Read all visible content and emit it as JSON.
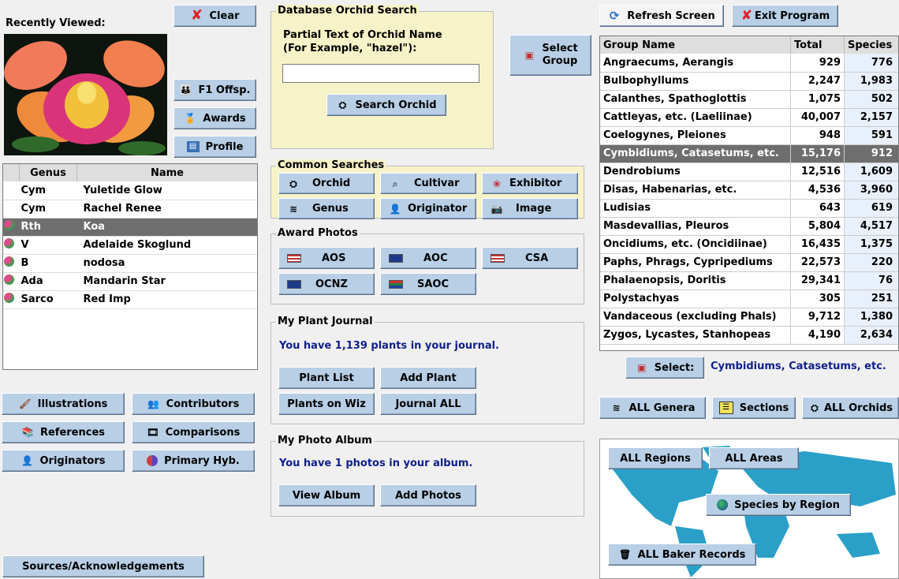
{
  "recent": {
    "title": "Recently Viewed:",
    "clear": "Clear",
    "f1": "F1 Offsp.",
    "awards": "Awards",
    "profile": "Profile",
    "headers": [
      "Genus",
      "Name"
    ],
    "rows": [
      {
        "genus": "Cym",
        "name": "Yuletide Glow",
        "icon": false
      },
      {
        "genus": "Cym",
        "name": "Rachel Renee",
        "icon": false
      },
      {
        "genus": "Rth",
        "name": "Koa",
        "icon": true
      },
      {
        "genus": "V",
        "name": "Adelaide Skoglund",
        "icon": true
      },
      {
        "genus": "B",
        "name": "nodosa",
        "icon": true
      },
      {
        "genus": "Ada",
        "name": "Mandarin Star",
        "icon": true
      },
      {
        "genus": "Sarco",
        "name": "Red Imp",
        "icon": true
      }
    ],
    "selected_row": 2
  },
  "left_buttons": {
    "illustrations": "Illustrations",
    "contributors": "Contributors",
    "references": "References",
    "comparisons": "Comparisons",
    "originators": "Originators",
    "primary_hyb": "Primary Hyb.",
    "sources": "Sources/Acknowledgements"
  },
  "search": {
    "legend": "Database Orchid Search",
    "prompt_line1": "Partial Text of Orchid Name",
    "prompt_line2": "(For Example, \"hazel\"):",
    "value": "",
    "button": "Search Orchid"
  },
  "select_group": {
    "line1": "Select",
    "line2": "Group"
  },
  "common": {
    "legend": "Common Searches",
    "orchid": "Orchid",
    "cultivar": "Cultivar",
    "exhibitor": "Exhibitor",
    "genus": "Genus",
    "originator": "Originator",
    "image": "Image"
  },
  "awards_photos": {
    "legend": "Award Photos",
    "aos": "AOS",
    "aoc": "AOC",
    "csa": "CSA",
    "ocnz": "OCNZ",
    "saoc": "SAOC"
  },
  "journal": {
    "legend": "My Plant Journal",
    "message": "You have 1,139 plants in your journal.",
    "plant_list": "Plant List",
    "add_plant": "Add Plant",
    "plants_on_wiz": "Plants on Wiz",
    "journal_all": "Journal ALL"
  },
  "album": {
    "legend": "My Photo Album",
    "message": "You have 1 photos in your album.",
    "view": "View Album",
    "add": "Add Photos"
  },
  "top_right": {
    "refresh": "Refresh Screen",
    "exit": "Exit Program"
  },
  "groups": {
    "headers": [
      "Group Name",
      "Total",
      "Species"
    ],
    "rows": [
      {
        "name": "Angraecums, Aerangis",
        "total": "929",
        "species": "776"
      },
      {
        "name": "Bulbophyllums",
        "total": "2,247",
        "species": "1,983"
      },
      {
        "name": "Calanthes, Spathoglottis",
        "total": "1,075",
        "species": "502"
      },
      {
        "name": "Cattleyas, etc. (Laeliinae)",
        "total": "40,007",
        "species": "2,157"
      },
      {
        "name": "Coelogynes, Pleiones",
        "total": "948",
        "species": "591"
      },
      {
        "name": "Cymbidiums, Catasetums, etc.",
        "total": "15,176",
        "species": "912"
      },
      {
        "name": "Dendrobiums",
        "total": "12,516",
        "species": "1,609"
      },
      {
        "name": "Disas, Habenarias, etc.",
        "total": "4,536",
        "species": "3,960"
      },
      {
        "name": "Ludisias",
        "total": "643",
        "species": "619"
      },
      {
        "name": "Masdevallias, Pleuros",
        "total": "5,804",
        "species": "4,517"
      },
      {
        "name": "Oncidiums, etc. (Oncidiinae)",
        "total": "16,435",
        "species": "1,375"
      },
      {
        "name": "Paphs, Phrags, Cypripediums",
        "total": "22,573",
        "species": "220"
      },
      {
        "name": "Phalaenopsis, Doritis",
        "total": "29,341",
        "species": "76"
      },
      {
        "name": "Polystachyas",
        "total": "305",
        "species": "251"
      },
      {
        "name": "Vandaceous (excluding Phals)",
        "total": "9,712",
        "species": "1,380"
      },
      {
        "name": "Zygos, Lycastes, Stanhopeas",
        "total": "4,190",
        "species": "2,634"
      }
    ],
    "selected_row": 5
  },
  "select_bar": {
    "button": "Select:",
    "value": "Cymbidiums, Catasetums, etc."
  },
  "all_buttons": {
    "genera": "ALL Genera",
    "sections": "Sections",
    "orchids": "ALL Orchids"
  },
  "map": {
    "all_regions": "ALL Regions",
    "all_areas": "ALL Areas",
    "species_by_region": "Species by Region",
    "baker": "ALL Baker Records"
  },
  "colors": {
    "accent_button": "#b8cfe6",
    "selected_row": "#6e6e6e",
    "panel_yellow": "#f7f3c8",
    "map_water": "#2aa0c8",
    "navy_text": "#10208a"
  }
}
